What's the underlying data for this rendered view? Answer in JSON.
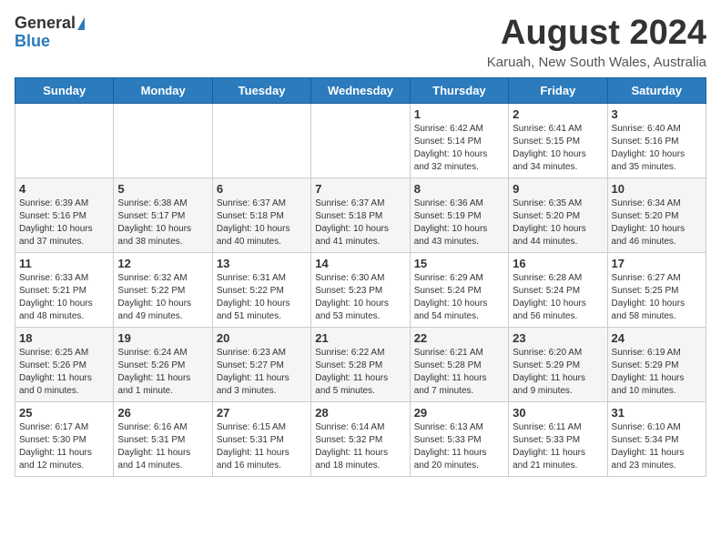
{
  "header": {
    "logo_general": "General",
    "logo_blue": "Blue",
    "title": "August 2024",
    "subtitle": "Karuah, New South Wales, Australia"
  },
  "weekdays": [
    "Sunday",
    "Monday",
    "Tuesday",
    "Wednesday",
    "Thursday",
    "Friday",
    "Saturday"
  ],
  "weeks": [
    [
      {
        "day": "",
        "info": ""
      },
      {
        "day": "",
        "info": ""
      },
      {
        "day": "",
        "info": ""
      },
      {
        "day": "",
        "info": ""
      },
      {
        "day": "1",
        "info": "Sunrise: 6:42 AM\nSunset: 5:14 PM\nDaylight: 10 hours\nand 32 minutes."
      },
      {
        "day": "2",
        "info": "Sunrise: 6:41 AM\nSunset: 5:15 PM\nDaylight: 10 hours\nand 34 minutes."
      },
      {
        "day": "3",
        "info": "Sunrise: 6:40 AM\nSunset: 5:16 PM\nDaylight: 10 hours\nand 35 minutes."
      }
    ],
    [
      {
        "day": "4",
        "info": "Sunrise: 6:39 AM\nSunset: 5:16 PM\nDaylight: 10 hours\nand 37 minutes."
      },
      {
        "day": "5",
        "info": "Sunrise: 6:38 AM\nSunset: 5:17 PM\nDaylight: 10 hours\nand 38 minutes."
      },
      {
        "day": "6",
        "info": "Sunrise: 6:37 AM\nSunset: 5:18 PM\nDaylight: 10 hours\nand 40 minutes."
      },
      {
        "day": "7",
        "info": "Sunrise: 6:37 AM\nSunset: 5:18 PM\nDaylight: 10 hours\nand 41 minutes."
      },
      {
        "day": "8",
        "info": "Sunrise: 6:36 AM\nSunset: 5:19 PM\nDaylight: 10 hours\nand 43 minutes."
      },
      {
        "day": "9",
        "info": "Sunrise: 6:35 AM\nSunset: 5:20 PM\nDaylight: 10 hours\nand 44 minutes."
      },
      {
        "day": "10",
        "info": "Sunrise: 6:34 AM\nSunset: 5:20 PM\nDaylight: 10 hours\nand 46 minutes."
      }
    ],
    [
      {
        "day": "11",
        "info": "Sunrise: 6:33 AM\nSunset: 5:21 PM\nDaylight: 10 hours\nand 48 minutes."
      },
      {
        "day": "12",
        "info": "Sunrise: 6:32 AM\nSunset: 5:22 PM\nDaylight: 10 hours\nand 49 minutes."
      },
      {
        "day": "13",
        "info": "Sunrise: 6:31 AM\nSunset: 5:22 PM\nDaylight: 10 hours\nand 51 minutes."
      },
      {
        "day": "14",
        "info": "Sunrise: 6:30 AM\nSunset: 5:23 PM\nDaylight: 10 hours\nand 53 minutes."
      },
      {
        "day": "15",
        "info": "Sunrise: 6:29 AM\nSunset: 5:24 PM\nDaylight: 10 hours\nand 54 minutes."
      },
      {
        "day": "16",
        "info": "Sunrise: 6:28 AM\nSunset: 5:24 PM\nDaylight: 10 hours\nand 56 minutes."
      },
      {
        "day": "17",
        "info": "Sunrise: 6:27 AM\nSunset: 5:25 PM\nDaylight: 10 hours\nand 58 minutes."
      }
    ],
    [
      {
        "day": "18",
        "info": "Sunrise: 6:25 AM\nSunset: 5:26 PM\nDaylight: 11 hours\nand 0 minutes."
      },
      {
        "day": "19",
        "info": "Sunrise: 6:24 AM\nSunset: 5:26 PM\nDaylight: 11 hours\nand 1 minute."
      },
      {
        "day": "20",
        "info": "Sunrise: 6:23 AM\nSunset: 5:27 PM\nDaylight: 11 hours\nand 3 minutes."
      },
      {
        "day": "21",
        "info": "Sunrise: 6:22 AM\nSunset: 5:28 PM\nDaylight: 11 hours\nand 5 minutes."
      },
      {
        "day": "22",
        "info": "Sunrise: 6:21 AM\nSunset: 5:28 PM\nDaylight: 11 hours\nand 7 minutes."
      },
      {
        "day": "23",
        "info": "Sunrise: 6:20 AM\nSunset: 5:29 PM\nDaylight: 11 hours\nand 9 minutes."
      },
      {
        "day": "24",
        "info": "Sunrise: 6:19 AM\nSunset: 5:29 PM\nDaylight: 11 hours\nand 10 minutes."
      }
    ],
    [
      {
        "day": "25",
        "info": "Sunrise: 6:17 AM\nSunset: 5:30 PM\nDaylight: 11 hours\nand 12 minutes."
      },
      {
        "day": "26",
        "info": "Sunrise: 6:16 AM\nSunset: 5:31 PM\nDaylight: 11 hours\nand 14 minutes."
      },
      {
        "day": "27",
        "info": "Sunrise: 6:15 AM\nSunset: 5:31 PM\nDaylight: 11 hours\nand 16 minutes."
      },
      {
        "day": "28",
        "info": "Sunrise: 6:14 AM\nSunset: 5:32 PM\nDaylight: 11 hours\nand 18 minutes."
      },
      {
        "day": "29",
        "info": "Sunrise: 6:13 AM\nSunset: 5:33 PM\nDaylight: 11 hours\nand 20 minutes."
      },
      {
        "day": "30",
        "info": "Sunrise: 6:11 AM\nSunset: 5:33 PM\nDaylight: 11 hours\nand 21 minutes."
      },
      {
        "day": "31",
        "info": "Sunrise: 6:10 AM\nSunset: 5:34 PM\nDaylight: 11 hours\nand 23 minutes."
      }
    ]
  ]
}
